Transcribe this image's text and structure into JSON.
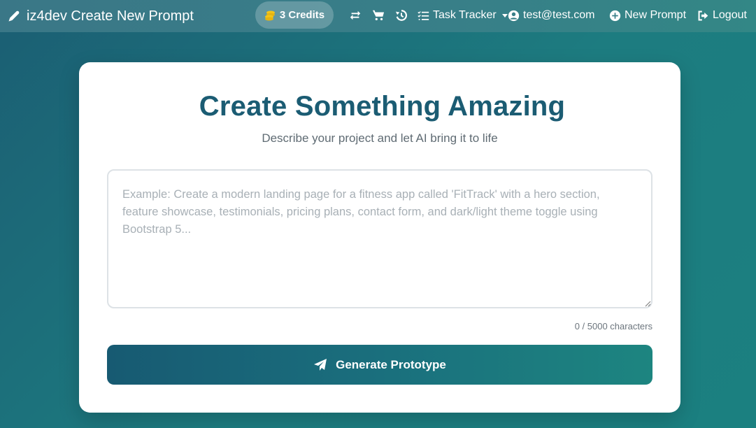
{
  "navbar": {
    "brand": "iz4dev Create New Prompt",
    "credits_label": "3 Credits",
    "task_tracker": "Task Tracker",
    "user_email": "test@test.com",
    "new_prompt": "New Prompt",
    "logout": "Logout",
    "icons": [
      "pencil-icon",
      "coins-icon",
      "repeat-icon",
      "cart-icon",
      "history-icon",
      "list-check-icon",
      "user-circle-icon",
      "plus-circle-icon",
      "logout-icon"
    ]
  },
  "main": {
    "title": "Create Something Amazing",
    "subtitle": "Describe your project and let AI bring it to life",
    "prompt": {
      "value": "",
      "placeholder": "Example: Create a modern landing page for a fitness app called 'FitTrack' with a hero section, feature showcase, testimonials, pricing plans, contact form, and dark/light theme toggle using Bootstrap 5..."
    },
    "char_count": "0 / 5000 characters",
    "generate_label": "Generate Prototype"
  },
  "colors": {
    "accent": "#1b5c73",
    "credits_coin": "#f5c518"
  }
}
